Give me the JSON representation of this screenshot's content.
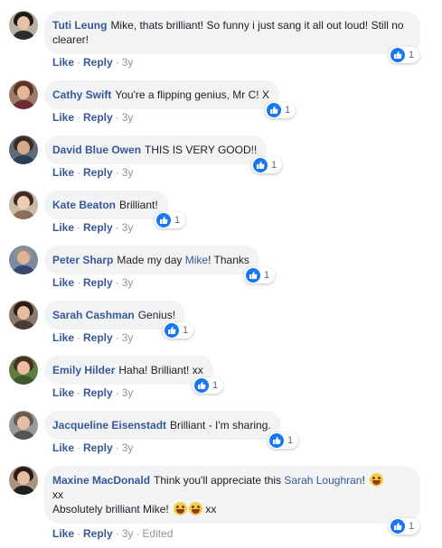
{
  "actions": {
    "like": "Like",
    "reply": "Reply",
    "dot": "·"
  },
  "comments": [
    {
      "author": "Tuti Leung",
      "text": "Mike, thats brilliant! So funny i just sang it all out loud! Still no clearer!",
      "reaction_count": "1",
      "time": "3y"
    },
    {
      "author": "Cathy Swift",
      "text": "You're a flipping genius, Mr C! X",
      "reaction_count": "1",
      "time": "3y"
    },
    {
      "author": "David Blue Owen",
      "text": "THIS IS VERY GOOD!!",
      "reaction_count": "1",
      "time": "3y"
    },
    {
      "author": "Kate Beaton",
      "text": "Brilliant!",
      "reaction_count": "1",
      "time": "3y"
    },
    {
      "author": "Peter Sharp",
      "text_before": "Made my day ",
      "mention": "Mike",
      "text_after": "! Thanks",
      "reaction_count": "1",
      "time": "3y"
    },
    {
      "author": "Sarah Cashman",
      "text": "Genius!",
      "reaction_count": "1",
      "time": "3y"
    },
    {
      "author": "Emily Hilder",
      "text": "Haha! Brilliant! xx",
      "reaction_count": "1",
      "time": "3y"
    },
    {
      "author": "Jacqueline Eisenstadt",
      "text": "Brilliant - I'm sharing.",
      "reaction_count": "1",
      "time": "3y"
    },
    {
      "author": "Maxine MacDonald",
      "text_before": "Think you'll appreciate this ",
      "mention": "Sarah Loughran",
      "text_after": "!",
      "line2": "xx",
      "line3": "Absolutely brilliant Mike!",
      "line3_end": "xx",
      "reaction_count": "1",
      "time": "3y",
      "edited": "Edited",
      "emoji": "grinning-face"
    }
  ],
  "colors": {
    "bubble": "#f2f3f5",
    "name_link": "#385898",
    "like_blue": "#1877f2",
    "meta_grey": "#90949c"
  }
}
